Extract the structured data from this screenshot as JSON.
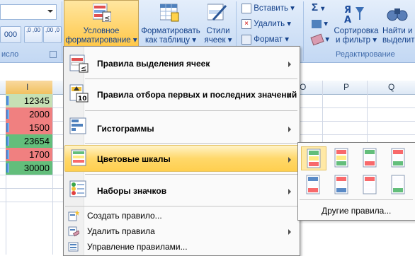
{
  "ribbon": {
    "number_group_label": "исло",
    "cond_format_label_1": "Условное",
    "cond_format_label_2": "форматирование",
    "format_table_label_1": "Форматировать",
    "format_table_label_2": "как таблицу",
    "cell_styles_label_1": "Стили",
    "cell_styles_label_2": "ячеек",
    "insert_label": "Вставить",
    "delete_label": "Удалить",
    "format_label": "Формат",
    "sort_label_1": "Сортировка",
    "sort_label_2": "и фильтр",
    "find_label_1": "Найти и",
    "find_label_2": "выделить",
    "editing_group_label": "Редактирование",
    "sigma": "Σ",
    "percent_format": "000",
    "inc_decimal": ",0 ,00",
    "dec_decimal": ",00 ,0"
  },
  "columns": [
    "I",
    "O",
    "P",
    "Q"
  ],
  "cells": [
    {
      "value": "12345",
      "color": "#c6e0b4"
    },
    {
      "value": "2000",
      "color": "#f08080"
    },
    {
      "value": "1500",
      "color": "#f08080"
    },
    {
      "value": "23654",
      "color": "#63be7b"
    },
    {
      "value": "1700",
      "color": "#f08080"
    },
    {
      "value": "30000",
      "color": "#63be7b"
    }
  ],
  "menu": {
    "highlight_rules": "Правила выделения ячеек",
    "top_bottom_rules": "Правила отбора первых и последних значений",
    "data_bars": "Гистограммы",
    "color_scales": "Цветовые шкалы",
    "icon_sets": "Наборы значков",
    "new_rule": "Создать правило...",
    "clear_rules": "Удалить правила",
    "manage_rules": "Управление правилами..."
  },
  "submenu": {
    "more_rules": "Другие правила..."
  },
  "icon_top_bottom_text": "10"
}
